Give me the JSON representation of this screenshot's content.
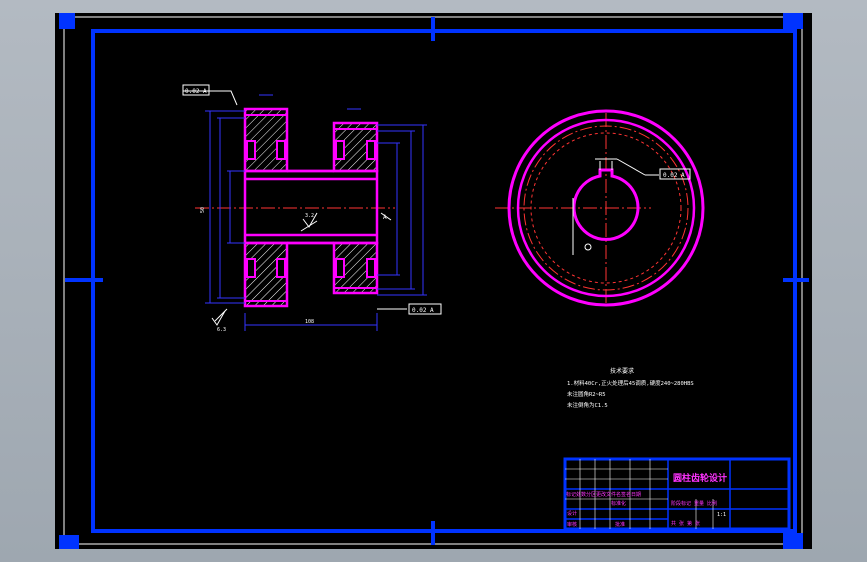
{
  "drawing": {
    "title_block": {
      "part_name": "圆柱齿轮设计",
      "row_left": "标记处数分区更改文件名签名日期",
      "row_left2": "设计",
      "row_left3": "审核",
      "standard": "标准化",
      "stage_labels": "阶段标记 重量 比例",
      "scale": "1:1",
      "sheet_info": "共 张 第 张",
      "approve": "批准"
    },
    "tech_req": {
      "heading": "技术要求",
      "line1": "1.材料40Cr,正火处理后45调质,硬度240~280HBS",
      "line2": "未注圆角R2~R5",
      "line3": "未注倒角为C1.5"
    },
    "labels": {
      "datum_a": "A",
      "tol_top": "0.02 A",
      "tol_bottom": "0.02 A",
      "tol_right": "0.02 A",
      "roughness_1": "3.2",
      "roughness_2": "1.6",
      "roughness_3": "6.3",
      "dim_width": "108",
      "dim_hub": "50"
    },
    "colors": {
      "frame": "#0033ff",
      "outline": "#ff00ff",
      "dimension": "#3333ff",
      "centerline": "#ff3333",
      "text": "#ffffff"
    }
  }
}
